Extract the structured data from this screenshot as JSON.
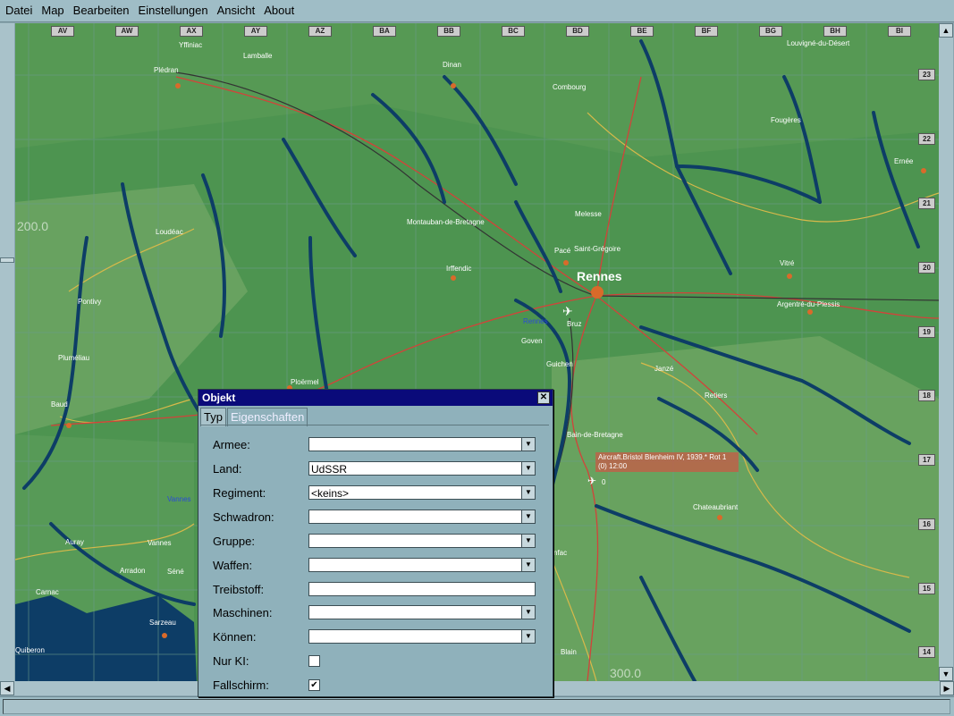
{
  "menu": [
    "Datei",
    "Map",
    "Bearbeiten",
    "Einstellungen",
    "Ansicht",
    "About"
  ],
  "map": {
    "grid_columns": [
      "AV",
      "AW",
      "AX",
      "AY",
      "AZ",
      "BA",
      "BB",
      "BC",
      "BD",
      "BE",
      "BF",
      "BG",
      "BH",
      "BI"
    ],
    "grid_rows": [
      "23",
      "22",
      "21",
      "20",
      "19",
      "18",
      "17",
      "16",
      "15",
      "14"
    ],
    "towns": [
      "Yffiniac",
      "Plédran",
      "Lamballe",
      "Dinan",
      "Combourg",
      "Louvigné-du-Désert",
      "Fougères",
      "Ernée",
      "Loudéac",
      "Montauban-de-Bretagne",
      "Melesse",
      "Pacé",
      "Saint-Grégoire",
      "Rennes",
      "Vitré",
      "Irffendic",
      "Argentré-du-Plessis",
      "Pontivy",
      "Bruz",
      "Goven",
      "Guichen",
      "Janzé",
      "Retiers",
      "Ploërmel",
      "Pluméliau",
      "Baud",
      "Bain-de-Bretagne",
      "Chateaubriant",
      "Vannes",
      "Auray",
      "Vannes",
      "Séné",
      "Arradon",
      "Carnac",
      "Sarzeau",
      "Quiberon",
      "Blain",
      "nfac",
      "Rennes"
    ],
    "coord_labels": [
      "200.0",
      "300.0"
    ],
    "aircraft_label": [
      "Aircraft.Bristol Blenheim IV, 1939.* Rot 1",
      "(0) 12:00"
    ],
    "aircraft_count": "0",
    "colors": {
      "land": "#4d9450",
      "river": "#0d3d66",
      "road_major": "#d2433a",
      "road_minor": "#d8b94a",
      "sea": "#0d3d66"
    }
  },
  "dialog": {
    "title": "Objekt",
    "tabs": [
      "Typ",
      "Eigenschaften"
    ],
    "fields": [
      {
        "label": "Armee:",
        "type": "combo",
        "value": ""
      },
      {
        "label": "Land:",
        "type": "combo",
        "value": "UdSSR"
      },
      {
        "label": "Regiment:",
        "type": "combo",
        "value": "<keins>"
      },
      {
        "label": "Schwadron:",
        "type": "combo",
        "value": ""
      },
      {
        "label": "Gruppe:",
        "type": "combo",
        "value": ""
      },
      {
        "label": "Waffen:",
        "type": "combo",
        "value": ""
      },
      {
        "label": "Treibstoff:",
        "type": "text",
        "value": ""
      },
      {
        "label": "Maschinen:",
        "type": "combo",
        "value": ""
      },
      {
        "label": "Können:",
        "type": "combo",
        "value": ""
      },
      {
        "label": "Nur KI:",
        "type": "check",
        "value": ""
      },
      {
        "label": "Fallschirm:",
        "type": "check",
        "value": "✔"
      }
    ]
  }
}
